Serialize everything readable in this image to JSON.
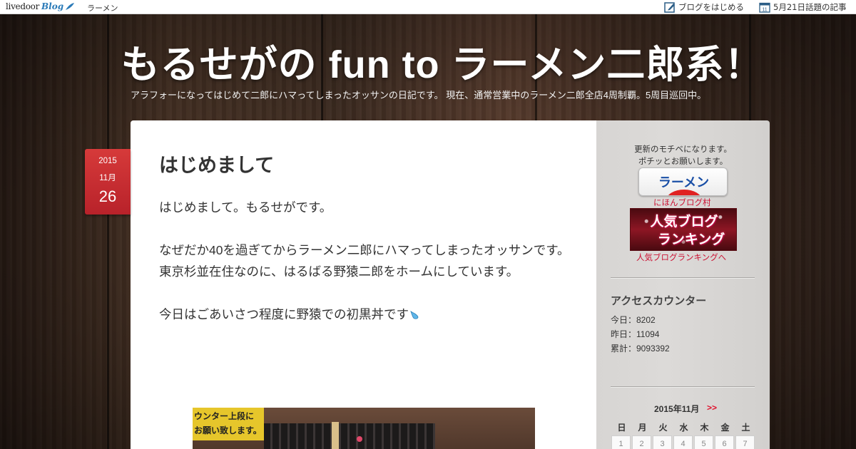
{
  "topbar": {
    "brand_livedoor": "livedoor",
    "brand_blog": "Blog",
    "category": "ラーメン",
    "start_blog": "ブログをはじめる",
    "today_topics": "5月21日話題の記事",
    "calendar_icon_day": "11"
  },
  "header": {
    "title": "もるせがの fun to ラーメン二郎系！",
    "description": "アラフォーになってはじめて二郎にハマってしまったオッサンの日記です。 現在、通常営業中のラーメン二郎全店4周制覇。5周目巡回中。"
  },
  "post": {
    "date": {
      "year": "2015",
      "month": "11月",
      "day": "26"
    },
    "title": "はじめまして",
    "body": [
      "はじめまして。もるせがです。",
      "なぜだか40を過ぎてからラーメン二郎にハマってしまったオッサンです。",
      "東京杉並在住なのに、はるばる野猿二郎をホームにしています。",
      "今日はごあいさつ程度に野猿での初黒丼です"
    ],
    "photo_sign_line1": "ウンター上段に",
    "photo_sign_line2": "お願い致します。"
  },
  "sidebar": {
    "motivation_line1": "更新のモチベになります。",
    "motivation_line2": "ポチッとお願いします。",
    "ramen_button": "ラーメン",
    "nihon_blog_link": "にほんブログ村",
    "ranking_banner_line1": "人気ブログ",
    "ranking_banner_line2": "ランキング",
    "ranking_link": "人気ブログランキングへ",
    "counter": {
      "title": "アクセスカウンター",
      "today": "今日：8202",
      "yesterday": "昨日：11094",
      "total": "累計：9093392"
    },
    "calendar": {
      "title": "2015年11月",
      "next": ">>",
      "weekdays": [
        "日",
        "月",
        "火",
        "水",
        "木",
        "金",
        "土"
      ],
      "days": [
        "1",
        "2",
        "3",
        "4",
        "5",
        "6",
        "7"
      ]
    }
  },
  "colors": {
    "date_badge": "#c8282f",
    "link_red": "#cc1133",
    "brand_blue": "#2a7ab8"
  }
}
